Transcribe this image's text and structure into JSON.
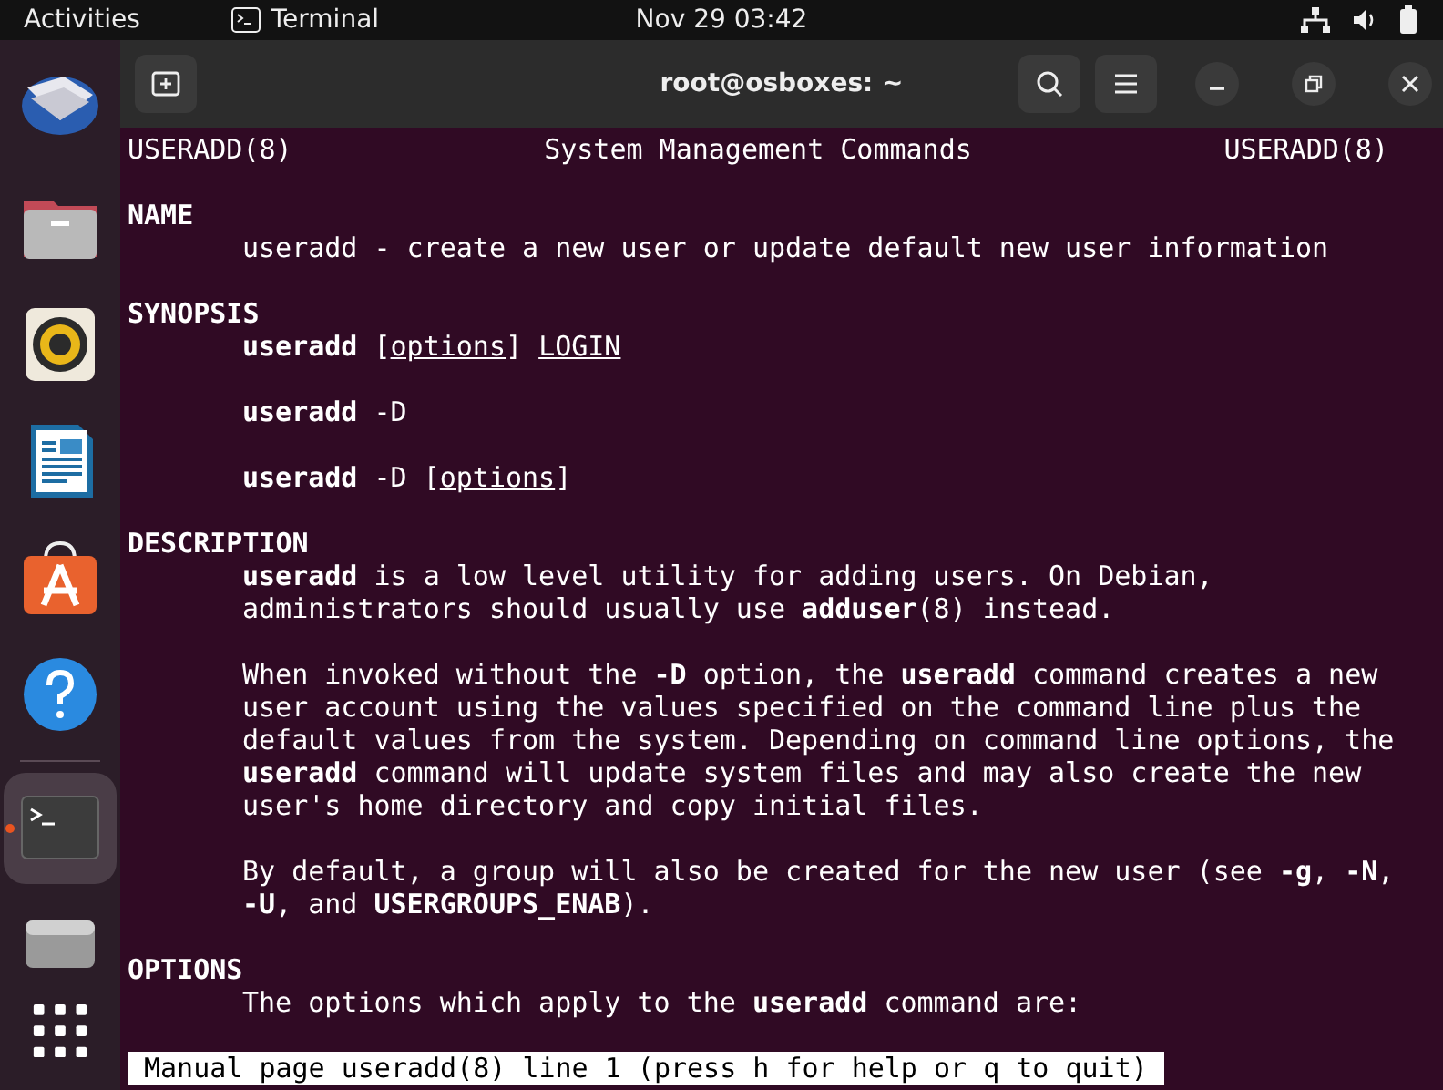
{
  "top_bar": {
    "activities": "Activities",
    "app_name": "Terminal",
    "clock": "Nov 29  03:42"
  },
  "dock": {
    "apps": [
      {
        "kind": "mail",
        "active": false
      },
      {
        "kind": "files",
        "active": false
      },
      {
        "kind": "music",
        "active": false
      },
      {
        "kind": "writer",
        "active": false
      },
      {
        "kind": "store",
        "active": false
      },
      {
        "kind": "help",
        "active": false
      },
      {
        "kind": "terminal",
        "active": true
      },
      {
        "kind": "drive",
        "active": false
      }
    ]
  },
  "window": {
    "title": "root@osboxes: ~"
  },
  "terminal": {
    "header": {
      "left": "USERADD(8)",
      "center": "System Management Commands",
      "right": "USERADD(8)"
    },
    "sections": [
      {
        "heading": "NAME",
        "paragraphs": [
          [
            [
              {
                "text": "useradd - create a new user or update default new user information",
                "kind": "plain"
              }
            ]
          ]
        ]
      },
      {
        "heading": "SYNOPSIS",
        "paragraphs": [
          [
            [
              {
                "text": "useradd",
                "kind": "bold"
              },
              {
                "text": " [",
                "kind": "plain"
              },
              {
                "text": "options",
                "kind": "underline"
              },
              {
                "text": "] ",
                "kind": "plain"
              },
              {
                "text": "LOGIN",
                "kind": "underline"
              }
            ]
          ],
          [
            [
              {
                "text": "useradd",
                "kind": "bold"
              },
              {
                "text": " -D",
                "kind": "plain"
              }
            ]
          ],
          [
            [
              {
                "text": "useradd",
                "kind": "bold"
              },
              {
                "text": " -D [",
                "kind": "plain"
              },
              {
                "text": "options",
                "kind": "underline"
              },
              {
                "text": "]",
                "kind": "plain"
              }
            ]
          ]
        ]
      },
      {
        "heading": "DESCRIPTION",
        "paragraphs": [
          [
            [
              {
                "text": "useradd",
                "kind": "bold"
              },
              {
                "text": " is a low level utility for adding users. On Debian,",
                "kind": "plain"
              }
            ],
            [
              {
                "text": "administrators should usually use ",
                "kind": "plain"
              },
              {
                "text": "adduser",
                "kind": "bold"
              },
              {
                "text": "(8) instead.",
                "kind": "plain"
              }
            ]
          ],
          [
            [
              {
                "text": "When invoked without the ",
                "kind": "plain"
              },
              {
                "text": "-D",
                "kind": "bold"
              },
              {
                "text": " option, the ",
                "kind": "plain"
              },
              {
                "text": "useradd",
                "kind": "bold"
              },
              {
                "text": " command creates a new",
                "kind": "plain"
              }
            ],
            [
              {
                "text": "user account using the values specified on the command line plus the",
                "kind": "plain"
              }
            ],
            [
              {
                "text": "default values from the system. Depending on command line options, the",
                "kind": "plain"
              }
            ],
            [
              {
                "text": "useradd",
                "kind": "bold"
              },
              {
                "text": " command will update system files and may also create the new",
                "kind": "plain"
              }
            ],
            [
              {
                "text": "user's home directory and copy initial files.",
                "kind": "plain"
              }
            ]
          ],
          [
            [
              {
                "text": "By default, a group will also be created for the new user (see ",
                "kind": "plain"
              },
              {
                "text": "-g",
                "kind": "bold"
              },
              {
                "text": ", ",
                "kind": "plain"
              },
              {
                "text": "-N",
                "kind": "bold"
              },
              {
                "text": ",",
                "kind": "plain"
              }
            ],
            [
              {
                "text": "-U",
                "kind": "bold"
              },
              {
                "text": ", and ",
                "kind": "plain"
              },
              {
                "text": "USERGROUPS_ENAB",
                "kind": "bold"
              },
              {
                "text": ").",
                "kind": "plain"
              }
            ]
          ]
        ]
      },
      {
        "heading": "OPTIONS",
        "paragraphs": [
          [
            [
              {
                "text": "The options which apply to the ",
                "kind": "plain"
              },
              {
                "text": "useradd",
                "kind": "bold"
              },
              {
                "text": " command are:",
                "kind": "plain"
              }
            ]
          ]
        ]
      }
    ],
    "status": "Manual page useradd(8) line 1 (press h for help or q to quit)"
  }
}
